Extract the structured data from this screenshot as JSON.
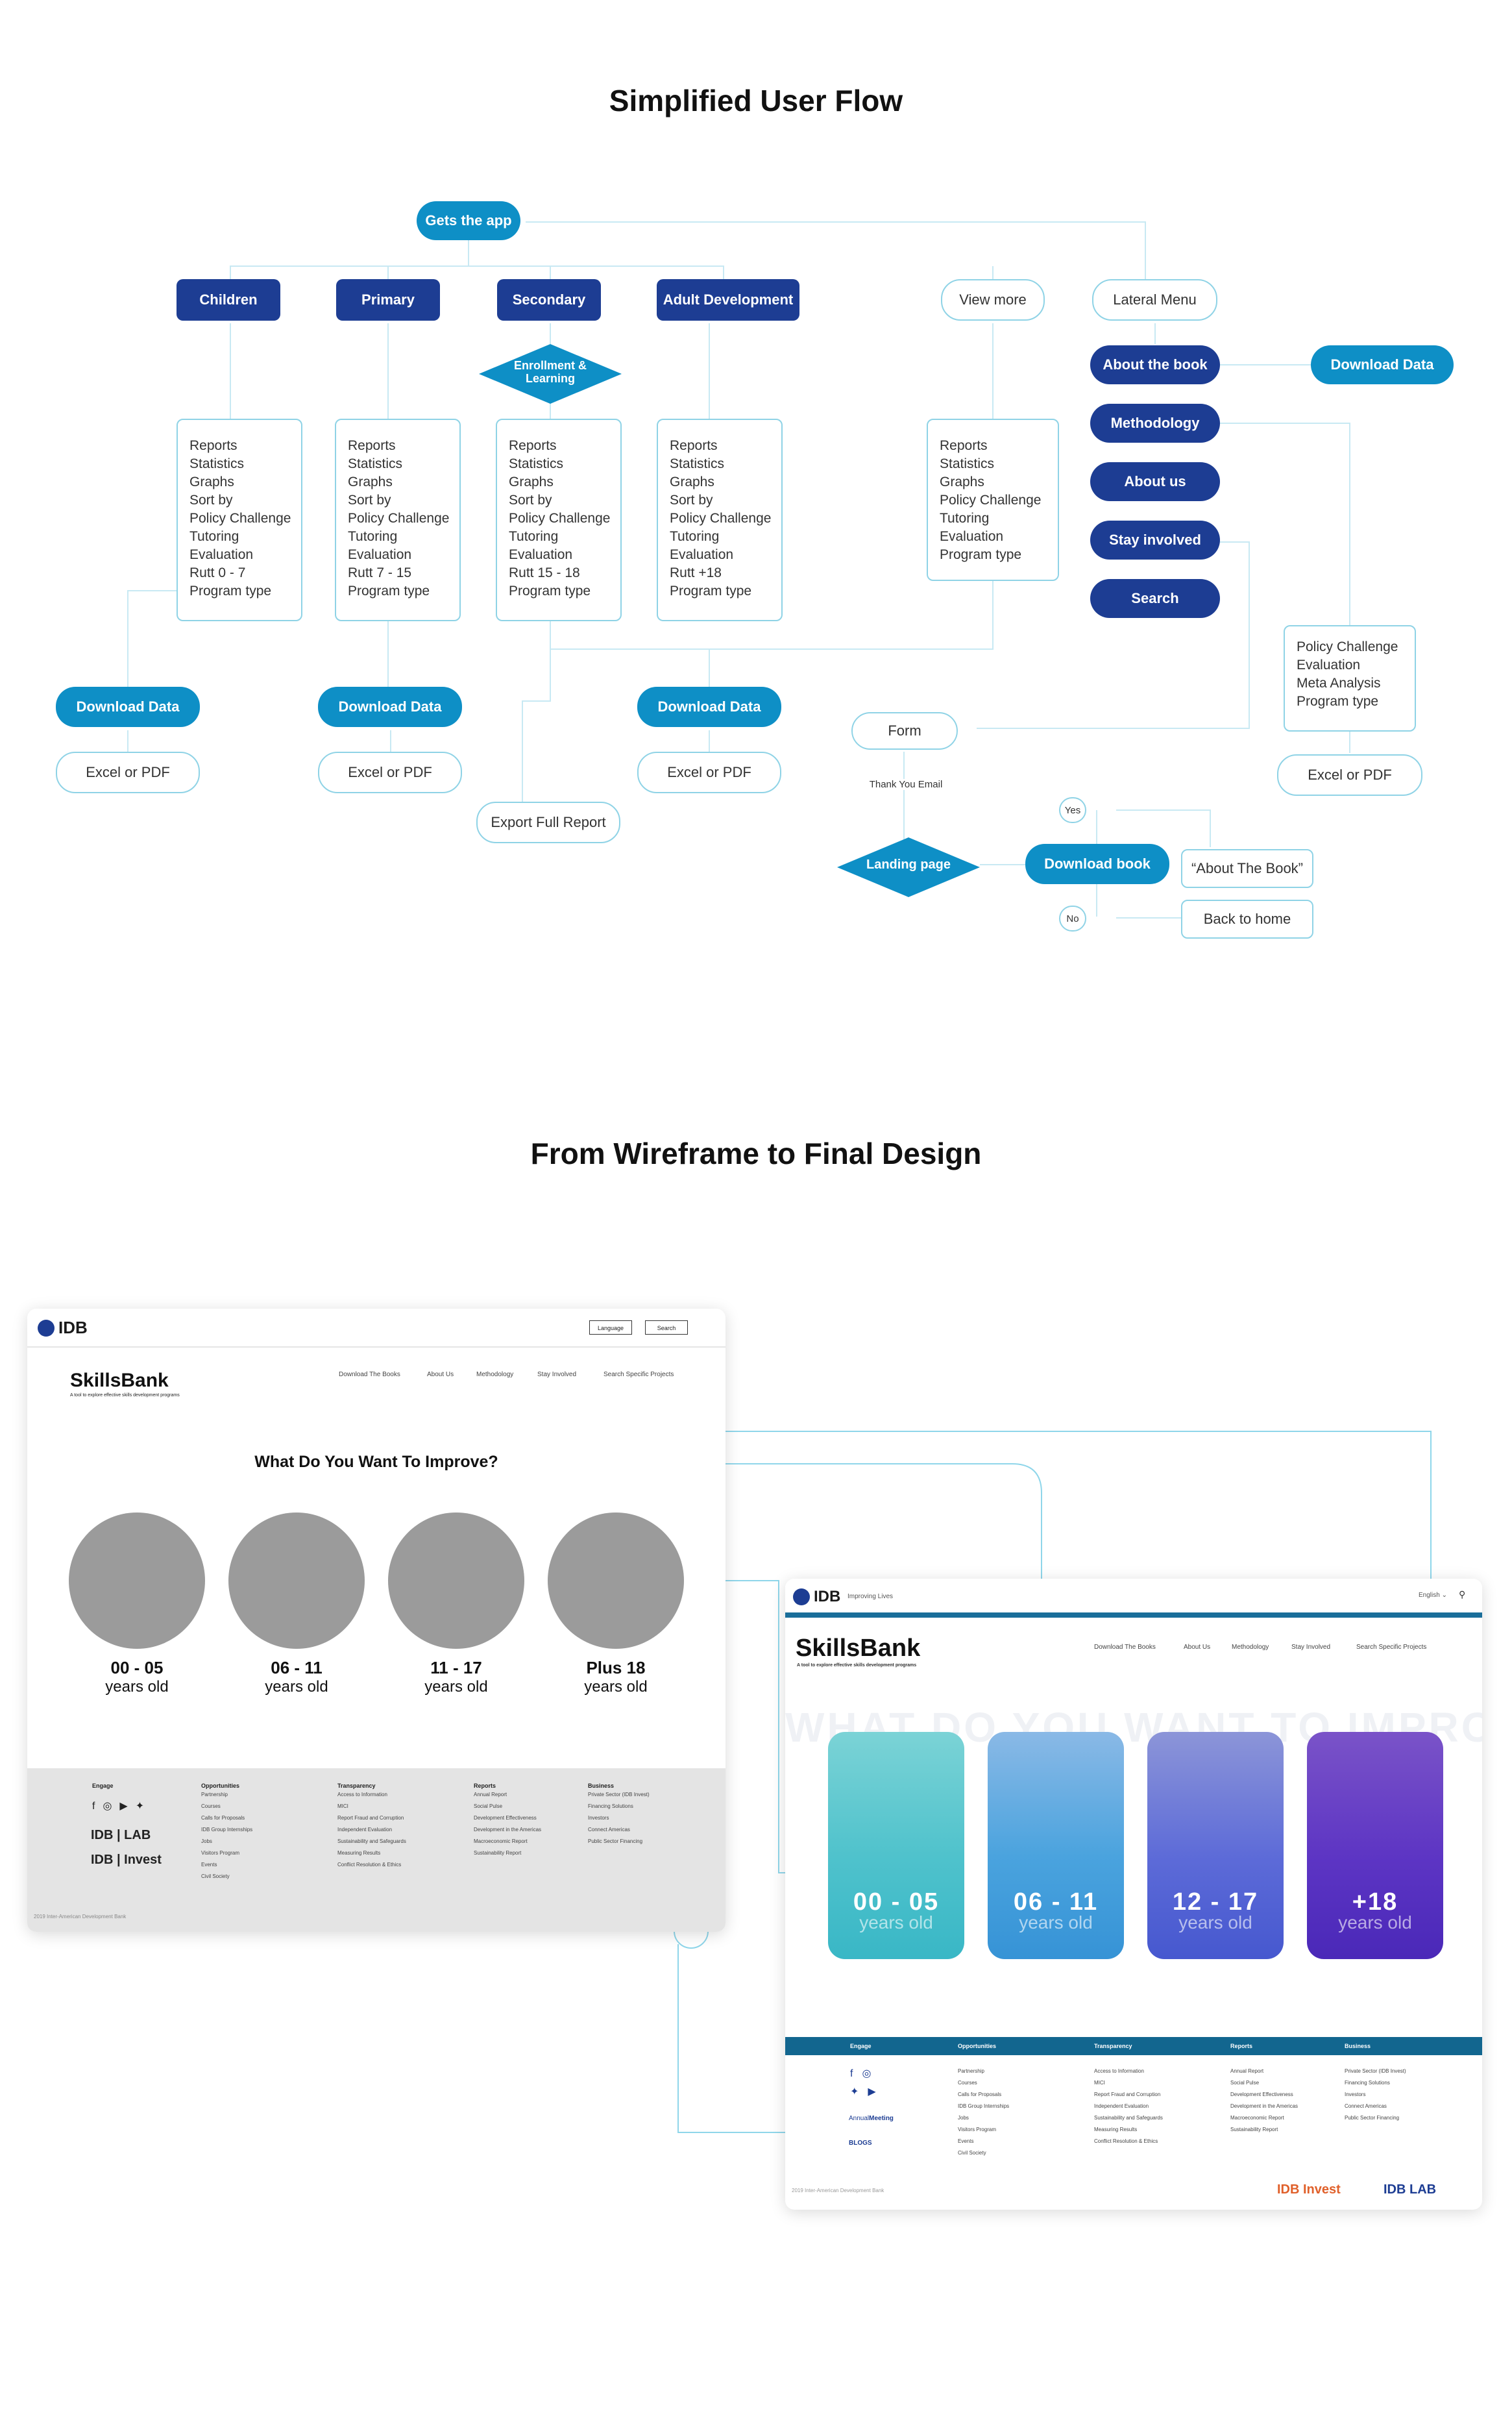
{
  "titles": {
    "flow": "Simplified User Flow",
    "wire": "From Wireframe to Final Design"
  },
  "flow": {
    "gets_app": "Gets the app",
    "children": "Children",
    "primary": "Primary",
    "secondary": "Secondary",
    "adult": "Adult Development",
    "view_more": "View more",
    "lateral_menu": "Lateral Menu",
    "enrollment": [
      "Enrollment &",
      "Learning"
    ],
    "about_book": "About the book",
    "methodology": "Methodology",
    "about_us": "About us",
    "stay_involved": "Stay involved",
    "search": "Search",
    "download_data": "Download Data",
    "excel_pdf": "Excel or PDF",
    "export_full": "Export Full Report",
    "form": "Form",
    "thank_you": "Thank You Email",
    "landing": "Landing page",
    "download_book": "Download book",
    "yes": "Yes",
    "no": "No",
    "about_the_book_q": "“About The Book”",
    "back_home": "Back to home",
    "boxes": {
      "children": [
        "Reports",
        "Statistics",
        "Graphs",
        "Sort by",
        "Policy Challenge",
        "Tutoring",
        "Evaluation",
        "Rutt 0 - 7",
        "Program type"
      ],
      "primary": [
        "Reports",
        "Statistics",
        "Graphs",
        "Sort by",
        "Policy Challenge",
        "Tutoring",
        "Evaluation",
        "Rutt  7 - 15",
        "Program type"
      ],
      "secondary": [
        "Reports",
        "Statistics",
        "Graphs",
        "Sort by",
        "Policy Challenge",
        "Tutoring",
        "Evaluation",
        "Rutt 15 - 18",
        "Program type"
      ],
      "adult": [
        "Reports",
        "Statistics",
        "Graphs",
        "Sort by",
        "Policy Challenge",
        "Tutoring",
        "Evaluation",
        "Rutt +18",
        "Program type"
      ],
      "view_more": [
        "Reports",
        "Statistics",
        "Graphs",
        "Policy Challenge",
        "Tutoring",
        "Evaluation",
        "Program type"
      ],
      "methodology": [
        "Policy Challenge",
        "Evaluation",
        "Meta Analysis",
        "Program type"
      ]
    }
  },
  "wireframe": {
    "logo": "IDB",
    "language": "Language",
    "search": "Search",
    "brand": "SkillsBank",
    "tagline": "A tool to explore effective skills development programs",
    "nav": [
      "Download The Books",
      "About Us",
      "Methodology",
      "Stay Involved",
      "Search Specific Projects"
    ],
    "question": "What Do You Want To Improve?",
    "ages": [
      {
        "range": "00 - 05",
        "sub": "years old"
      },
      {
        "range": "06 - 11",
        "sub": "years old"
      },
      {
        "range": "11 - 17",
        "sub": "years old"
      },
      {
        "range": "Plus 18",
        "sub": "years old"
      }
    ],
    "footer": {
      "engage": "Engage",
      "lab": "IDB | LAB",
      "invest": "IDB | Invest",
      "cols": [
        {
          "h": "Opportunities",
          "items": [
            "Partnership",
            "Courses",
            "Calls for Proposals",
            "IDB Group Internships",
            "Jobs",
            "Visitors Program",
            "Events",
            "Civil Society"
          ]
        },
        {
          "h": "Transparency",
          "items": [
            "Access to Information",
            "MICI",
            "Report Fraud and Corruption",
            "Independent Evaluation",
            "Sustainability and Safeguards",
            "Measuring Results",
            "Conflict Resolution & Ethics"
          ]
        },
        {
          "h": "Reports",
          "items": [
            "Annual Report",
            "Social Pulse",
            "Development Effectiveness",
            "Development in the Americas",
            "Macroeconomic Report",
            "Sustainability Report"
          ]
        },
        {
          "h": "Business",
          "items": [
            "Private Sector (IDB Invest)",
            "Financing Solutions",
            "Investors",
            "Connect Americas",
            "Public Sector Financing"
          ]
        }
      ],
      "copyright": "2019 Inter-American Development Bank"
    }
  },
  "final": {
    "logo": "IDB",
    "logo_sub": "Improving Lives",
    "language": "English",
    "brand": "SkillsBank",
    "tagline": "A tool to explore effective skills development programs",
    "nav": [
      "Download The Books",
      "About Us",
      "Methodology",
      "Stay Involved",
      "Search Specific Projects"
    ],
    "ghost": "WHAT DO YOU WANT TO IMPROVE?",
    "ages": [
      {
        "range": "00 - 05",
        "sub": "years old"
      },
      {
        "range": "06 - 11",
        "sub": "years old"
      },
      {
        "range": "12 - 17",
        "sub": "years old"
      },
      {
        "range": "+18",
        "sub": "years old"
      }
    ],
    "footer": {
      "engage": "Engage",
      "annual_a": "Annual",
      "annual_b": "Meeting",
      "blogs": "BLOGS",
      "cols": [
        {
          "h": "Opportunities",
          "items": [
            "Partnership",
            "Courses",
            "Calls for Proposals",
            "IDB Group Internships",
            "Jobs",
            "Visitors Program",
            "Events",
            "Civil Society"
          ]
        },
        {
          "h": "Transparency",
          "items": [
            "Access to Information",
            "MICI",
            "Report Fraud and Corruption",
            "Independent Evaluation",
            "Sustainability and Safeguards",
            "Measuring Results",
            "Conflict Resolution & Ethics"
          ]
        },
        {
          "h": "Reports",
          "items": [
            "Annual Report",
            "Social Pulse",
            "Development Effectiveness",
            "Development in the Americas",
            "Macroeconomic Report",
            "Sustainability Report"
          ]
        },
        {
          "h": "Business",
          "items": [
            "Private Sector (IDB Invest)",
            "Financing Solutions",
            "Investors",
            "Connect Americas",
            "Public Sector Financing"
          ]
        }
      ],
      "copyright": "2019 Inter-American Development Bank",
      "invest": "IDB Invest",
      "lab": "IDB LAB"
    }
  },
  "colors": {
    "navy": "#1d3d93",
    "cyan": "#0e8fc6",
    "line": "#bfe8f3"
  }
}
